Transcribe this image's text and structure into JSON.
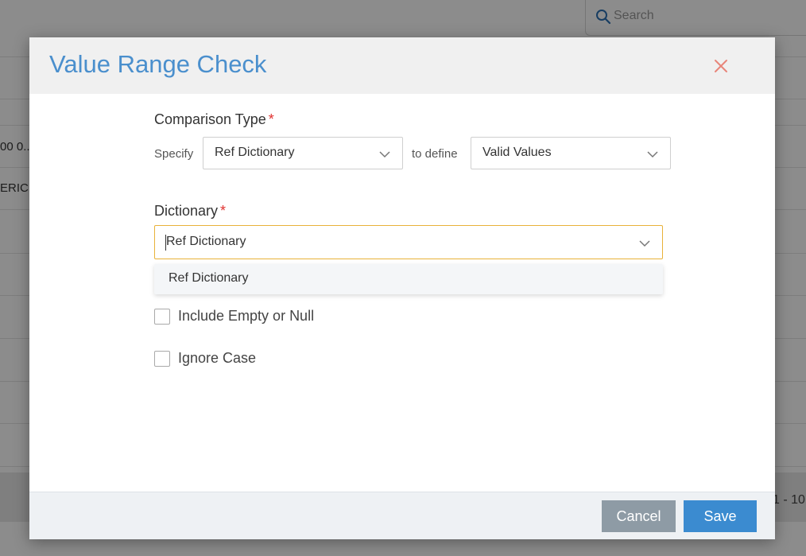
{
  "background": {
    "search_placeholder": "Search",
    "cells": [
      "00 0..",
      "ERIC"
    ],
    "pager_text": "1 - 10"
  },
  "modal": {
    "title": "Value Range Check",
    "comparison_type": {
      "label": "Comparison Type",
      "required_mark": "*",
      "specify_label": "Specify",
      "specify_value": "Ref Dictionary",
      "to_define_label": "to define",
      "define_value": "Valid Values"
    },
    "dictionary": {
      "label": "Dictionary",
      "required_mark": "*",
      "input_value": "Ref Dictionary",
      "options": [
        "Ref Dictionary"
      ]
    },
    "checkboxes": [
      {
        "label": "Include Empty or Null",
        "checked": false
      },
      {
        "label": "Ignore Case",
        "checked": false
      }
    ],
    "footer": {
      "cancel_label": "Cancel",
      "save_label": "Save"
    }
  },
  "colors": {
    "title": "#4a8fcd",
    "required": "#e0312f",
    "focus_border": "#e8b23a",
    "save_button": "#3b8bd0",
    "cancel_button": "#8e9ba5",
    "close_icon": "#e8857a"
  }
}
